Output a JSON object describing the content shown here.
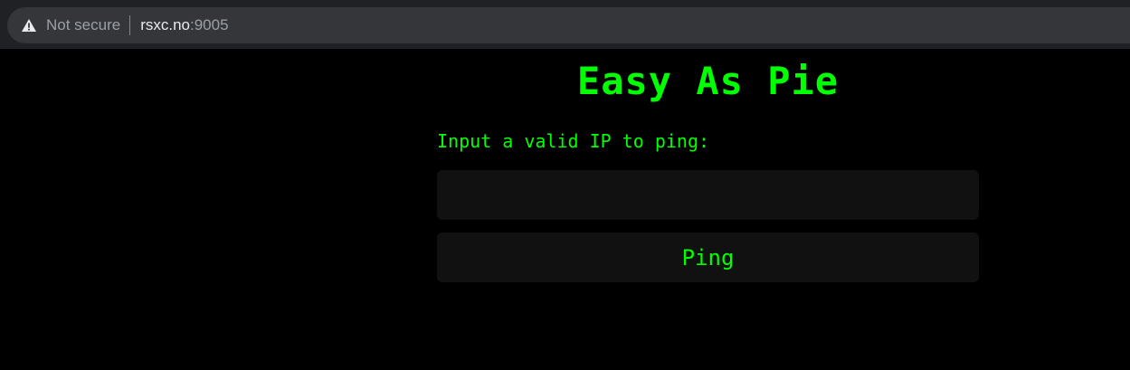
{
  "browser": {
    "security_label": "Not secure",
    "url_host": "rsxc.no",
    "url_port": ":9005",
    "warning_icon": "warning-triangle-icon"
  },
  "page": {
    "title": "Easy As Pie",
    "prompt_label": "Input a valid IP to ping:",
    "ip_input": {
      "value": "",
      "placeholder": ""
    },
    "ping_button_label": "Ping"
  },
  "colors": {
    "background": "#000000",
    "accent": "#00ff00",
    "field_background": "#111111",
    "browser_chrome": "#202124"
  }
}
